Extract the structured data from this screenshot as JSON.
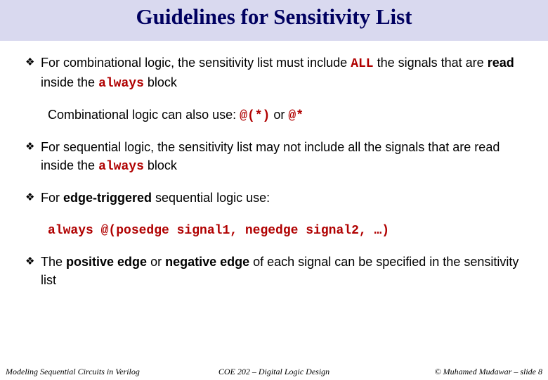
{
  "title": "Guidelines for Sensitivity List",
  "bullets": {
    "b1": {
      "t1": "For combinational logic, the sensitivity list must include ",
      "all": "ALL",
      "t2": " the signals that are ",
      "read": "read",
      "t3": " inside the ",
      "always": "always",
      "t4": " block"
    },
    "sub1": {
      "t1": "Combinational logic can also use: ",
      "c1": "@(*)",
      "t2": " or ",
      "c2": "@*"
    },
    "b2": {
      "t1": "For sequential logic, the sensitivity list may not include all the signals that are read inside the ",
      "always": "always",
      "t2": " block"
    },
    "b3": {
      "t1": "For ",
      "edge": "edge-triggered",
      "t2": " sequential logic use:"
    },
    "sub2": {
      "c1": "always @(posedge signal1, negedge signal2, …)"
    },
    "b4": {
      "t1": "The ",
      "pe": "positive edge",
      "t2": " or ",
      "ne": "negative edge",
      "t3": " of each signal can be specified in the sensitivity list"
    }
  },
  "footer": {
    "left": "Modeling Sequential Circuits in Verilog",
    "mid": "COE 202 – Digital Logic Design",
    "right": "© Muhamed Mudawar – slide 8"
  }
}
